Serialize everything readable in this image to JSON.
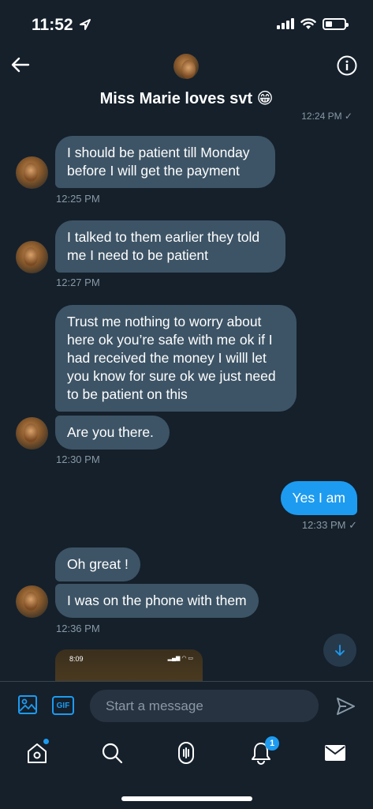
{
  "status_bar": {
    "time": "11:52"
  },
  "header": {
    "title": "Miss Marie loves svt 😁",
    "prev_time": "12:24 PM ✓"
  },
  "messages": [
    {
      "text": "I should be patient till Monday before I will get the payment",
      "time": "12:25 PM"
    },
    {
      "text": "I talked to them earlier they told me I need to be patient",
      "time": "12:27 PM"
    },
    {
      "text": "Trust me nothing to worry about here ok you’re safe with me ok if I had received the money I willl let you know for sure ok we just need to be patient on this"
    },
    {
      "text": "Are you there.",
      "time": "12:30 PM"
    },
    {
      "text": "Yes I am",
      "time": "12:33 PM ✓"
    },
    {
      "text": "Oh great !"
    },
    {
      "text": "I was on the phone with them",
      "time": "12:36 PM"
    }
  ],
  "preview": {
    "time": "8:09"
  },
  "composer": {
    "placeholder": "Start a message",
    "gif_label": "GIF"
  },
  "tabbar": {
    "notification_count": "1"
  },
  "colors": {
    "background": "#15202b",
    "incoming_bubble": "#3d5466",
    "outgoing_bubble": "#1d9bf0",
    "muted_text": "#8899a6"
  }
}
